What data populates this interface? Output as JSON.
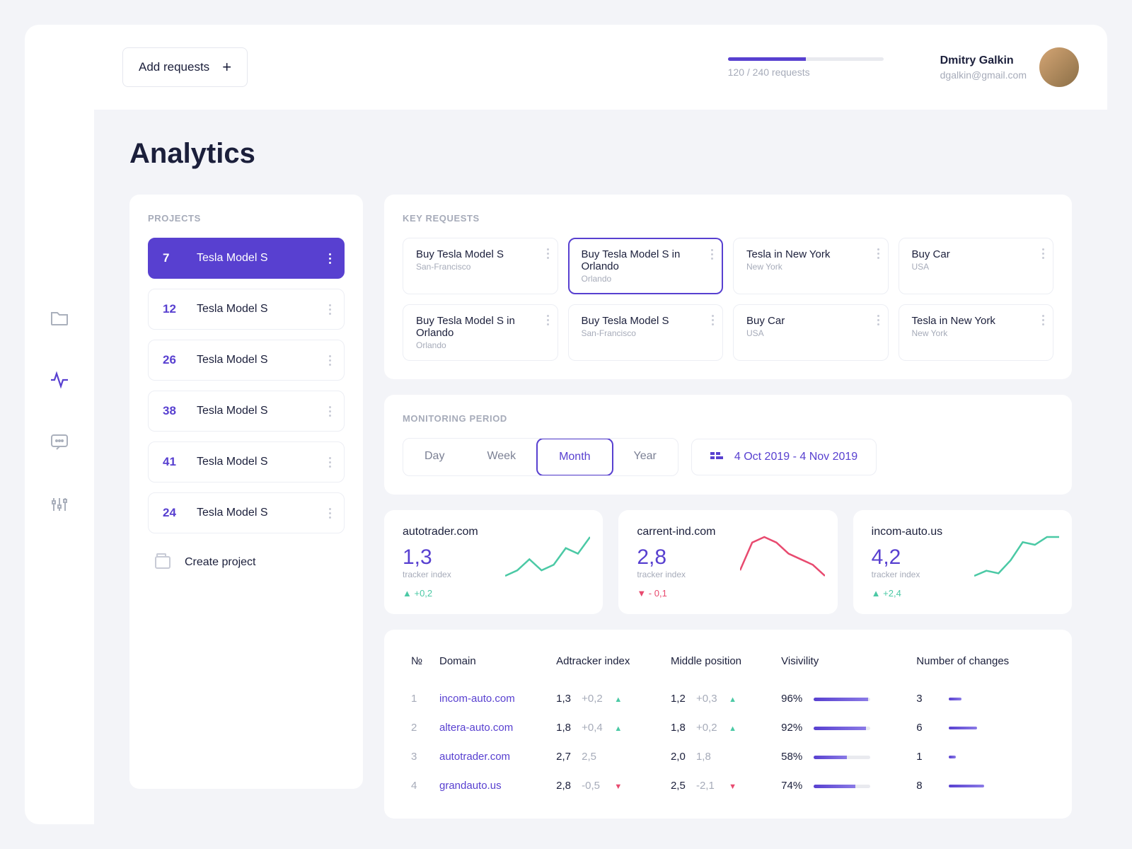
{
  "topbar": {
    "add_button": "Add requests",
    "progress": {
      "used": 120,
      "total": 240,
      "label": "120 / 240 requests",
      "percent": 50
    },
    "user": {
      "name": "Dmitry Galkin",
      "email": "dgalkin@gmail.com"
    }
  },
  "page_title": "Analytics",
  "projects": {
    "heading": "PROJECTS",
    "items": [
      {
        "num": "7",
        "name": "Tesla Model S",
        "active": true
      },
      {
        "num": "12",
        "name": "Tesla Model S",
        "active": false
      },
      {
        "num": "26",
        "name": "Tesla Model S",
        "active": false
      },
      {
        "num": "38",
        "name": "Tesla Model S",
        "active": false
      },
      {
        "num": "41",
        "name": "Tesla Model S",
        "active": false
      },
      {
        "num": "24",
        "name": "Tesla Model S",
        "active": false
      }
    ],
    "create_label": "Create project"
  },
  "requests": {
    "heading": "KEY REQUESTS",
    "items": [
      {
        "title": "Buy Tesla Model S",
        "sub": "San-Francisco",
        "selected": false
      },
      {
        "title": "Buy Tesla Model S in Orlando",
        "sub": "Orlando",
        "selected": true
      },
      {
        "title": "Tesla in New York",
        "sub": "New York",
        "selected": false
      },
      {
        "title": "Buy Car",
        "sub": "USA",
        "selected": false
      },
      {
        "title": "Buy Tesla Model S in Orlando",
        "sub": "Orlando",
        "selected": false
      },
      {
        "title": "Buy Tesla Model S",
        "sub": "San-Francisco",
        "selected": false
      },
      {
        "title": "Buy Car",
        "sub": "USA",
        "selected": false
      },
      {
        "title": "Tesla in New York",
        "sub": "New York",
        "selected": false
      }
    ]
  },
  "period": {
    "heading": "MONITORING PERIOD",
    "tabs": {
      "day": "Day",
      "week": "Week",
      "month": "Month",
      "year": "Year"
    },
    "active": "month",
    "range": "4 Oct 2019 - 4 Nov 2019"
  },
  "trackers": [
    {
      "domain": "autotrader.com",
      "value": "1,3",
      "label": "tracker index",
      "delta": "+0,2",
      "dir": "up"
    },
    {
      "domain": "carrent-ind.com",
      "value": "2,8",
      "label": "tracker index",
      "delta": "- 0,1",
      "dir": "down"
    },
    {
      "domain": "incom-auto.us",
      "value": "4,2",
      "label": "tracker index",
      "delta": "+2,4",
      "dir": "up"
    }
  ],
  "table": {
    "headers": {
      "num": "№",
      "domain": "Domain",
      "adtracker": "Adtracker index",
      "middle": "Middle position",
      "vis": "Visivility",
      "changes": "Number of changes"
    },
    "rows": [
      {
        "n": "1",
        "domain": "incom-auto.com",
        "ad_v": "1,3",
        "ad_d": "+0,2",
        "ad_dir": "up",
        "mid_v": "1,2",
        "mid_d": "+0,3",
        "mid_dir": "up",
        "vis": "96%",
        "vis_pct": 96,
        "ch": "3",
        "ch_w": 18
      },
      {
        "n": "2",
        "domain": "altera-auto.com",
        "ad_v": "1,8",
        "ad_d": "+0,4",
        "ad_dir": "up",
        "mid_v": "1,8",
        "mid_d": "+0,2",
        "mid_dir": "up",
        "vis": "92%",
        "vis_pct": 92,
        "ch": "6",
        "ch_w": 40
      },
      {
        "n": "3",
        "domain": "autotrader.com",
        "ad_v": "2,7",
        "ad_d": "2,5",
        "ad_dir": "",
        "mid_v": "2,0",
        "mid_d": "1,8",
        "mid_dir": "",
        "vis": "58%",
        "vis_pct": 58,
        "ch": "1",
        "ch_w": 10
      },
      {
        "n": "4",
        "domain": "grandauto.us",
        "ad_v": "2,8",
        "ad_d": "-0,5",
        "ad_dir": "down",
        "mid_v": "2,5",
        "mid_d": "-2,1",
        "mid_dir": "down",
        "vis": "74%",
        "vis_pct": 74,
        "ch": "8",
        "ch_w": 50
      }
    ]
  },
  "chart_data": [
    {
      "type": "line",
      "title": "autotrader.com",
      "ylabel": "tracker index",
      "series": [
        {
          "name": "index",
          "values": [
            1.0,
            1.1,
            1.3,
            1.1,
            1.2,
            1.5,
            1.4,
            1.7
          ]
        }
      ],
      "color": "#4bc9a5"
    },
    {
      "type": "line",
      "title": "carrent-ind.com",
      "ylabel": "tracker index",
      "series": [
        {
          "name": "index",
          "values": [
            2.4,
            2.9,
            3.0,
            2.9,
            2.7,
            2.6,
            2.5,
            2.3
          ]
        }
      ],
      "color": "#e84a6f"
    },
    {
      "type": "line",
      "title": "incom-auto.us",
      "ylabel": "tracker index",
      "series": [
        {
          "name": "index",
          "values": [
            3.0,
            3.2,
            3.1,
            3.6,
            4.3,
            4.2,
            4.5,
            4.5
          ]
        }
      ],
      "color": "#4bc9a5"
    }
  ]
}
